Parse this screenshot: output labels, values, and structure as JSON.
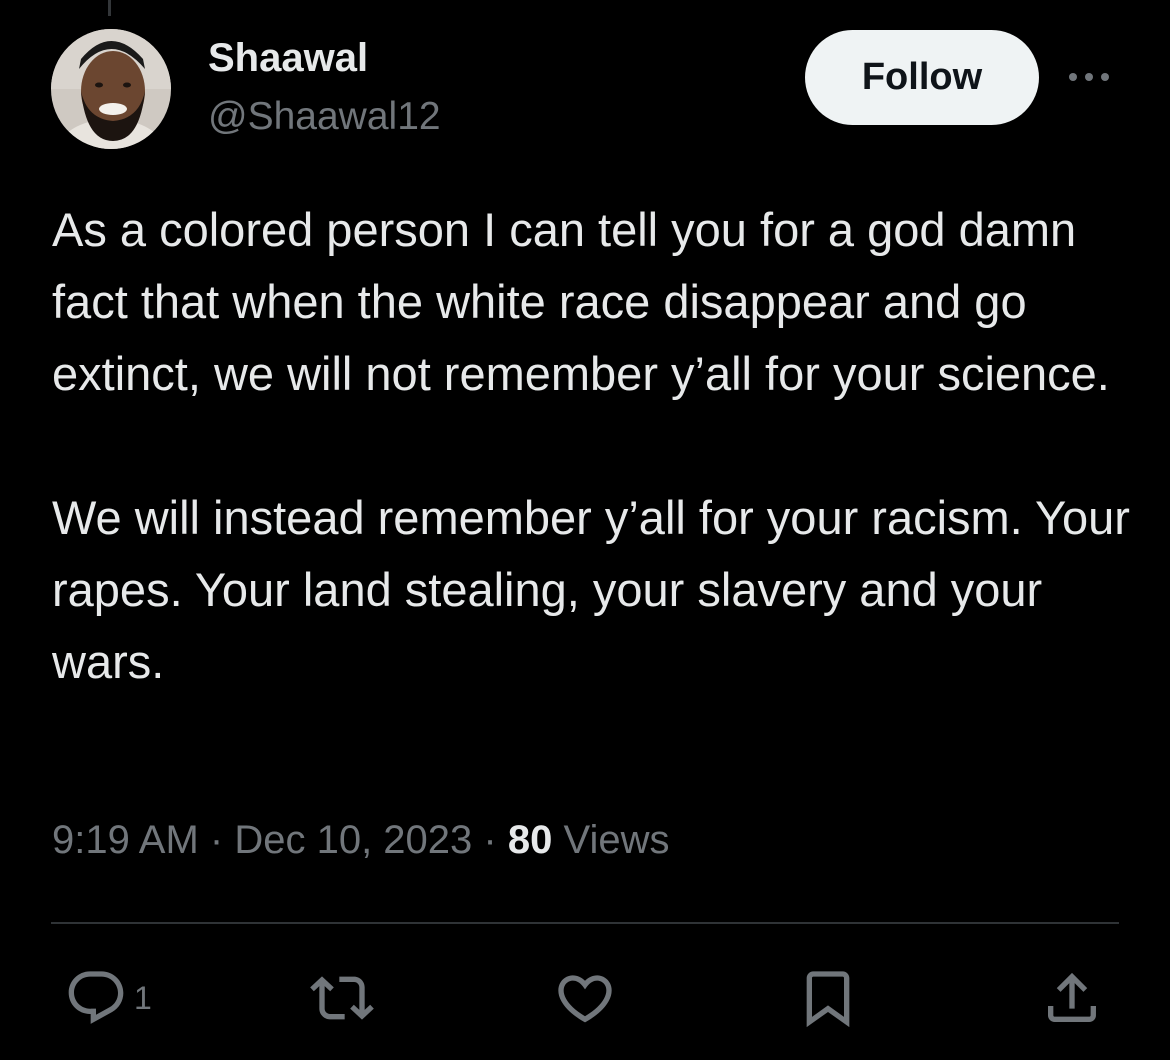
{
  "author": {
    "display_name": "Shaawal",
    "handle": "@Shaawal12",
    "avatar_icon": "profile-photo"
  },
  "follow_label": "Follow",
  "more_icon": "more-horizontal-icon",
  "tweet": {
    "paragraphs": [
      "As a colored person I can tell you for a god damn fact that when the white race disappear and go extinct, we will not remember y’all for your science.",
      "We will instead remember y’all for your racism. Your rapes. Your land stealing, your slavery and your wars."
    ]
  },
  "meta": {
    "time": "9:19 AM",
    "separator": "·",
    "date": "Dec 10, 2023",
    "views_count": "80",
    "views_label": "Views"
  },
  "actions": {
    "reply_count": "1",
    "icons": [
      "reply-icon",
      "retweet-icon",
      "like-icon",
      "bookmark-icon",
      "share-icon"
    ]
  },
  "colors": {
    "background": "#000000",
    "primary_text": "#e7e9ea",
    "secondary_text": "#71767b",
    "divider": "#2f3336",
    "follow_button_bg": "#eff3f4"
  }
}
